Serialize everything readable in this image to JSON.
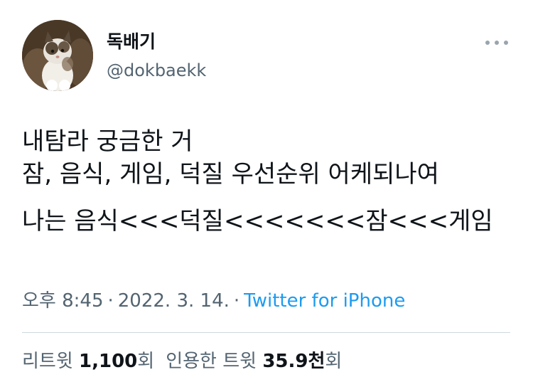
{
  "author": {
    "display_name": "독배기",
    "handle": "@dokbaekk"
  },
  "tweet": {
    "lines": [
      "내탐라 궁금한 거",
      "잠, 음식, 게임, 덕질 우선순위 어케되나여",
      "나는 음식<<<덕질<<<<<<<잠<<<게임"
    ],
    "time": "오후 8:45",
    "date": "2022. 3. 14.",
    "separator": "·",
    "source": "Twitter for iPhone"
  },
  "stats": {
    "retweets_label": "리트윗",
    "retweets_count": "1,100",
    "retweets_unit": "회",
    "quotes_label": "인용한 트윗",
    "quotes_count": "35.9천",
    "quotes_unit": "회"
  },
  "icons": {
    "more": "more-horizontal-icon",
    "avatar": "kitten-avatar"
  },
  "colors": {
    "text": "#0f1419",
    "secondary": "#536471",
    "link": "#1d9bf0",
    "divider": "#cfd9de"
  }
}
